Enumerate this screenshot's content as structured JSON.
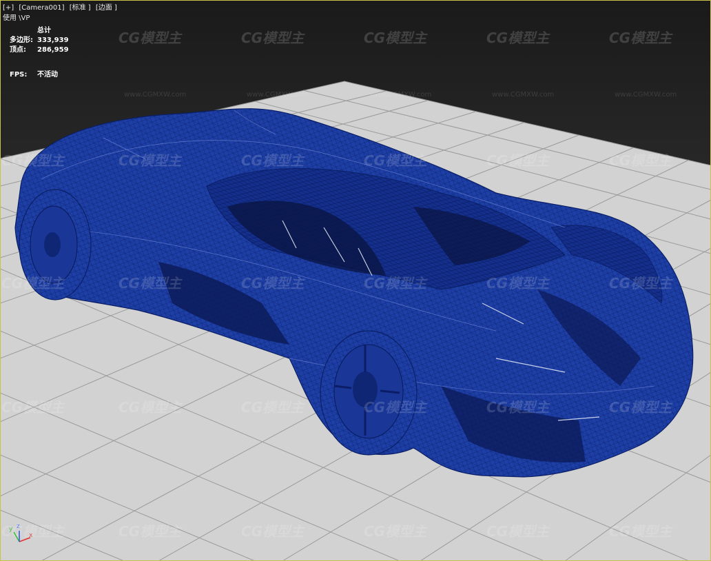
{
  "viewport_label": {
    "plus": "[+]",
    "camera": "[Camera001]",
    "shading_standard": "[标准 ]",
    "shading_edges": "[边面 ]"
  },
  "vp_mode": "使用 \\VP",
  "stats": {
    "header": "总计",
    "polys_label": "多边形:",
    "polys_value": "333,939",
    "verts_label": "顶点:",
    "verts_value": "286,959"
  },
  "fps": {
    "label": "FPS:",
    "value": "不活动"
  },
  "watermark": {
    "logo": "CG模型主",
    "url": "www.CGMXW.com"
  },
  "axis": {
    "x": "x",
    "y": "y",
    "z": "z"
  },
  "colors": {
    "wire": "#1e3fa6",
    "wire_dark": "#0d2470",
    "grid_plane": "#cfcfcf",
    "grid_line": "#9a9a9a",
    "viewport_border": "#c8c24a"
  }
}
